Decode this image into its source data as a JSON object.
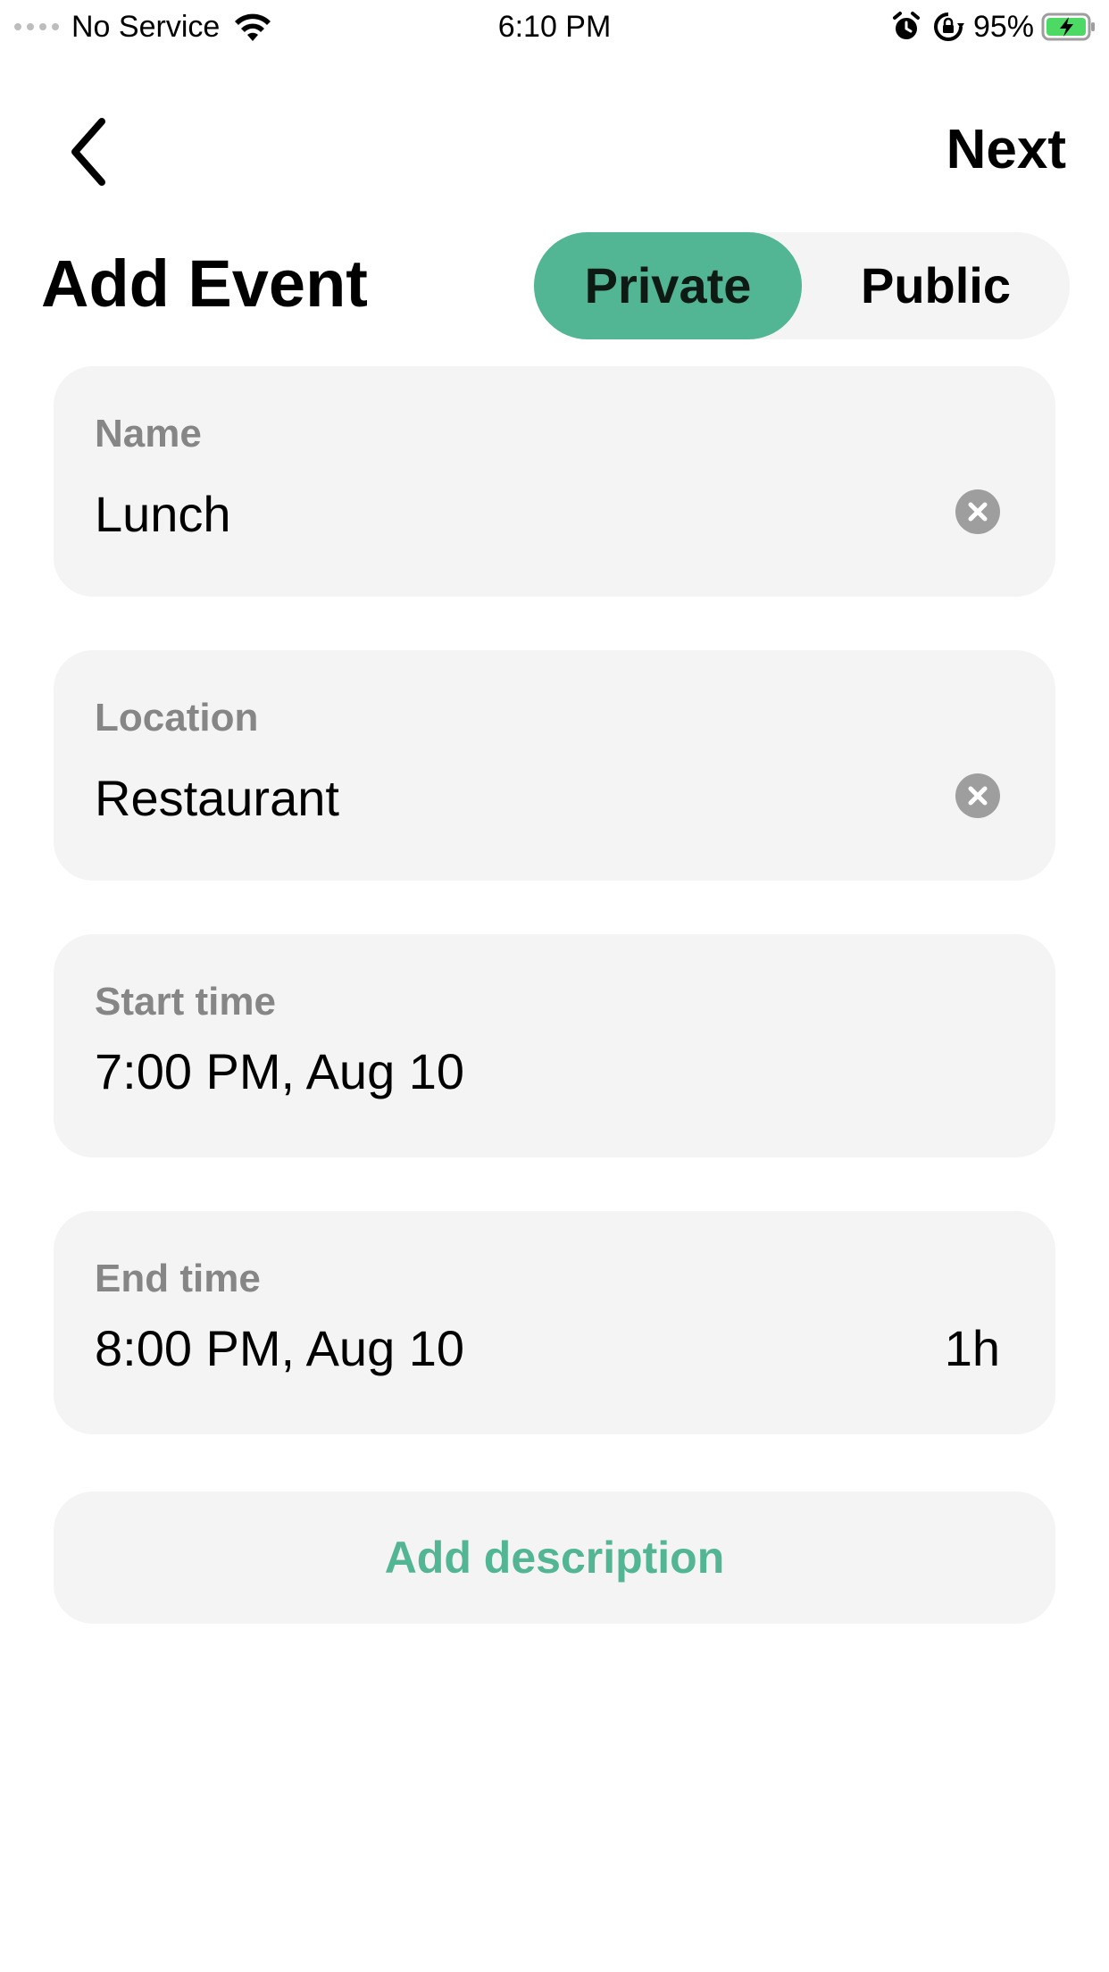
{
  "status_bar": {
    "carrier": "No Service",
    "time": "6:10 PM",
    "battery_percent": "95%"
  },
  "nav": {
    "next_label": "Next"
  },
  "header": {
    "title": "Add Event",
    "visibility": {
      "options": [
        "Private",
        "Public"
      ],
      "selected": "Private"
    }
  },
  "form": {
    "name": {
      "label": "Name",
      "value": "Lunch"
    },
    "location": {
      "label": "Location",
      "value": "Restaurant"
    },
    "start_time": {
      "label": "Start time",
      "value": "7:00 PM, Aug 10"
    },
    "end_time": {
      "label": "End time",
      "value": "8:00 PM, Aug 10",
      "duration": "1h"
    },
    "description_label": "Add description"
  },
  "colors": {
    "accent": "#52b593",
    "card_bg": "#f4f4f4",
    "label_gray": "#868686"
  }
}
